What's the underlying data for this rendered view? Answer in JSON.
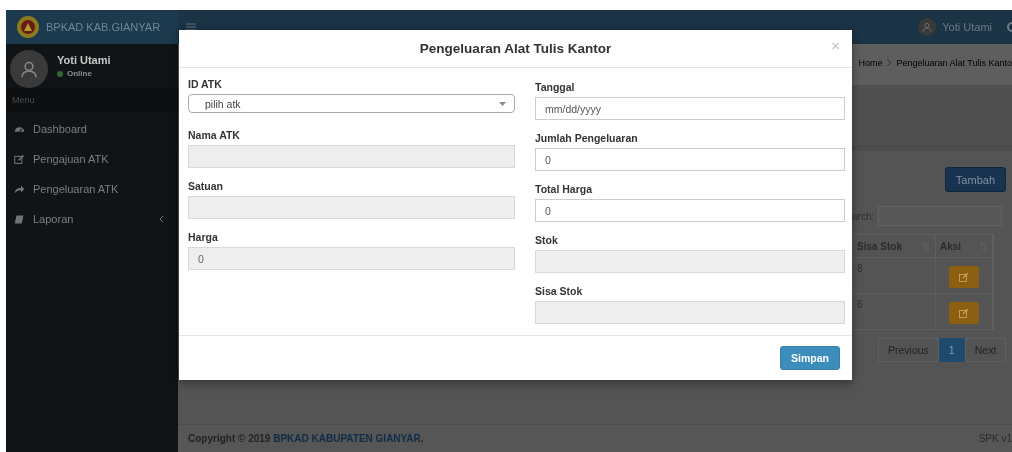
{
  "header": {
    "brand": "BPKAD KAB.GIANYAR",
    "user_name": "Yoti Utami"
  },
  "sidebar": {
    "user": {
      "name": "Yoti Utami",
      "status": "Online"
    },
    "menu_header": "Menu",
    "items": [
      {
        "label": "Dashboard",
        "kind": "link"
      },
      {
        "label": "Pengajuan ATK",
        "kind": "link"
      },
      {
        "label": "Pengeluaran ATK",
        "kind": "link"
      },
      {
        "label": "Laporan",
        "kind": "treeview"
      }
    ]
  },
  "content": {
    "breadcrumb": [
      "Home",
      "Pengeluaran Alat Tulis Kanto"
    ],
    "add_button": "Tambah",
    "search_label": "arch:",
    "table": {
      "columns": [
        "Sisa Stok",
        "Aksi"
      ],
      "rows": [
        [
          "8"
        ],
        [
          "6"
        ]
      ]
    },
    "pagination": [
      {
        "label": "Previous",
        "selected": false
      },
      {
        "label": "1",
        "selected": true
      },
      {
        "label": "Next",
        "selected": false
      }
    ]
  },
  "footer": {
    "copyright": "Copyright © 2019",
    "link": "BPKAD KABUPATEN GIANYAR.",
    "version": "SPK v1"
  },
  "modal": {
    "title": "Pengeluaran Alat Tulis Kantor",
    "close": "×",
    "columns": [
      [
        {
          "label": "ID ATK",
          "kind": "select",
          "value": "pilih atk",
          "disabled": false
        },
        {
          "label": "Nama ATK",
          "kind": "input",
          "disabled": true
        },
        {
          "label": "Satuan",
          "kind": "input",
          "disabled": true
        },
        {
          "label": "Harga",
          "kind": "input",
          "value": "0",
          "disabled": true
        }
      ],
      [
        {
          "label": "Tanggal",
          "kind": "input",
          "placeholder": "mm/dd/yyyy",
          "disabled": false
        },
        {
          "label": "Jumlah Pengeluaran",
          "kind": "input",
          "value": "0",
          "disabled": false
        },
        {
          "label": "Total Harga",
          "kind": "input",
          "value": "0",
          "disabled": false
        },
        {
          "label": "Stok",
          "kind": "input",
          "disabled": true
        },
        {
          "label": "Sisa Stok",
          "kind": "input",
          "disabled": true
        }
      ]
    ],
    "submit": "Simpan"
  }
}
